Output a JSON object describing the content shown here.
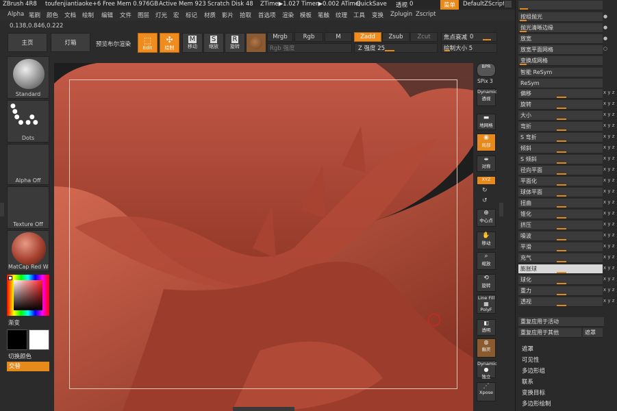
{
  "titlebar": {
    "app": "ZBrush 4R8",
    "doc": "toufenjiantiaoke+6",
    "free_mem": "Free Mem 0.976GB",
    "active_mem": "Active Mem 923",
    "scratch": "Scratch Disk 48",
    "ztime": "ZTime▶1.027 Timer▶0.002 ATimel",
    "quicksave": "QuickSave",
    "transparency_label": "透视",
    "transparency_value": "0",
    "menus_label": "菜单",
    "script": "DefaultZScript"
  },
  "menubar": [
    "Alpha",
    "笔刷",
    "颜色",
    "文档",
    "绘制",
    "编辑",
    "文件",
    "图层",
    "灯光",
    "宏",
    "标记",
    "材质",
    "影片",
    "拾取",
    "首选项",
    "渲染",
    "模板",
    "笔触",
    "纹理",
    "工具",
    "变换",
    "Zplugin",
    "Zscript"
  ],
  "coords": "0.138,0.846,0.222",
  "toolbar": {
    "home": "主页",
    "lightbox": "灯箱",
    "bpr": "预览布尔渲染",
    "edit": "Edit",
    "draw": "绘制",
    "move": "移动",
    "scale": "缩放",
    "rotate": "旋转",
    "mrgb": "Mrgb",
    "rgb": "Rgb",
    "m": "M",
    "rgb_intensity": "Rgb 强度",
    "zadd": "Zadd",
    "zsub": "Zsub",
    "zcut": "Zcut",
    "z_intensity": "Z 强度 25",
    "focal_label": "焦点衰减",
    "focal_value": "0",
    "draw_size": "绘制大小 5"
  },
  "left_shelf": {
    "brush": "Standard",
    "stroke": "Dots",
    "alpha": "Alpha Off",
    "texture": "Texture Off",
    "material": "MatCap Red Wa",
    "gradient": "渐变",
    "switch_color": "切换颜色",
    "alternate": "交替"
  },
  "right_tools": {
    "bpr": "BPR",
    "spix": "SPix 3",
    "dynamic": "Dynamic",
    "persp": "透视",
    "floor": "地网格",
    "local": "局部",
    "sym": "对称",
    "xyz": "XYZ",
    "center": "中心点",
    "move": "移动",
    "scale": "缩放",
    "rotate": "旋转",
    "linefill": "Line Fill",
    "polyf": "PolyF",
    "transp": "透明",
    "ghost": "幽灵",
    "solo": "独立",
    "xpose": "Xpose"
  },
  "panel": {
    "top_rows": [
      "按组抛光",
      "抛光清晰边缘",
      "放宽",
      "放宽平面网格",
      "变换成网格"
    ],
    "resym_smart": "智能 ReSym",
    "resym": "ReSym",
    "deformations": [
      "偏移",
      "旋转",
      "大小",
      "弯折",
      "S 弯折",
      "倾斜",
      "S 倾斜",
      "径向平面",
      "平面化",
      "球体平面",
      "扭曲",
      "锥化",
      "挤压",
      "噪波",
      "平滑",
      "充气",
      "膨胀球",
      "球化",
      "重力",
      "透视"
    ],
    "repeat_active": "重复应用于活动",
    "repeat_other": "重复应用于其他",
    "mask_btn": "遮罩",
    "sections": [
      "遮罩",
      "可见性",
      "多边形组",
      "联系",
      "变换目标",
      "多边形绘制"
    ]
  }
}
